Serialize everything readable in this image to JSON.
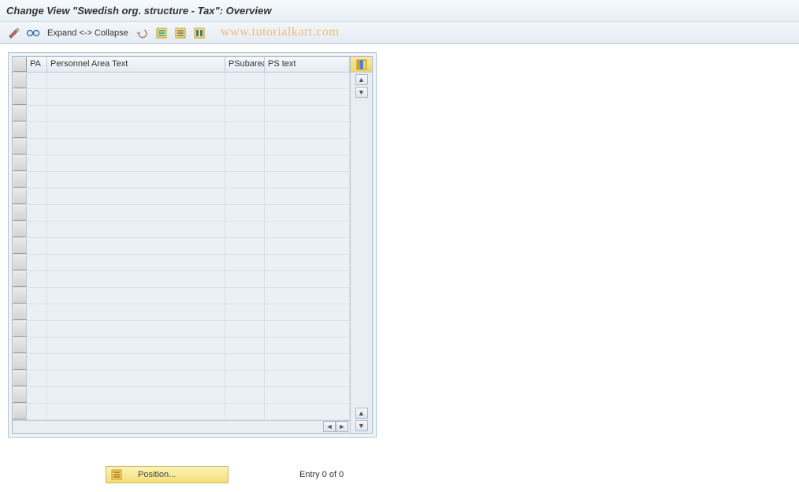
{
  "title": "Change View \"Swedish org. structure - Tax\": Overview",
  "toolbar": {
    "expand_label": "Expand <-> Collapse"
  },
  "watermark": "www.tutorialkart.com",
  "grid": {
    "columns": {
      "pa": "PA",
      "patext": "Personnel Area Text",
      "psub": "PSubarea",
      "pstext": "PS text"
    },
    "row_count": 21
  },
  "footer": {
    "position_label": "Position...",
    "entry_text": "Entry 0 of 0"
  }
}
